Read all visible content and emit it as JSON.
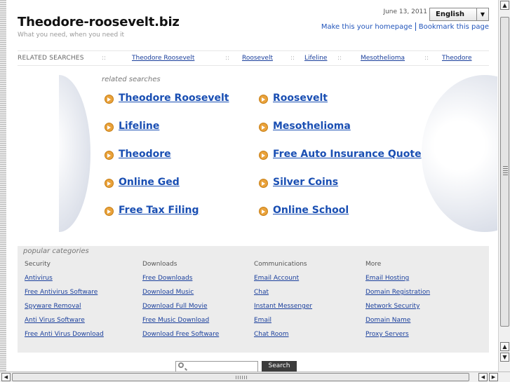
{
  "header": {
    "site_title": "Theodore-roosevelt.biz",
    "tagline": "What you need, when you need it",
    "date": "June 13, 2011",
    "language": "English",
    "homepage_link": "Make this your homepage",
    "bookmark_link": "Bookmark this page"
  },
  "related_bar": {
    "label": "RELATED SEARCHES",
    "separator": "::",
    "links": [
      "Theodore Roosevelt",
      "Roosevelt",
      "Lifeline",
      "Mesothelioma",
      "Theodore"
    ]
  },
  "related_searches": {
    "label": "related searches",
    "left": [
      "Theodore Roosevelt",
      "Lifeline",
      "Theodore",
      "Online Ged",
      "Free Tax Filing"
    ],
    "right": [
      "Roosevelt",
      "Mesothelioma",
      "Free Auto Insurance Quote",
      "Silver Coins",
      "Online School"
    ]
  },
  "popular": {
    "label": "popular categories",
    "columns": [
      {
        "title": "Security",
        "links": [
          "Antivirus",
          "Free Antivirus Software",
          "Spyware Removal",
          "Anti Virus Software",
          "Free Anti Virus Download"
        ]
      },
      {
        "title": "Downloads",
        "links": [
          "Free Downloads",
          "Download Music",
          "Download Full Movie",
          "Free Music Download",
          "Download Free Software"
        ]
      },
      {
        "title": "Communications",
        "links": [
          "Email Account",
          "Chat",
          "Instant Messenger",
          "Email",
          "Chat Room"
        ]
      },
      {
        "title": "More",
        "links": [
          "Email Hosting",
          "Domain Registration",
          "Network Security",
          "Domain Name",
          "Proxy Servers"
        ]
      }
    ]
  },
  "search": {
    "button_label": "Search",
    "input_value": ""
  }
}
